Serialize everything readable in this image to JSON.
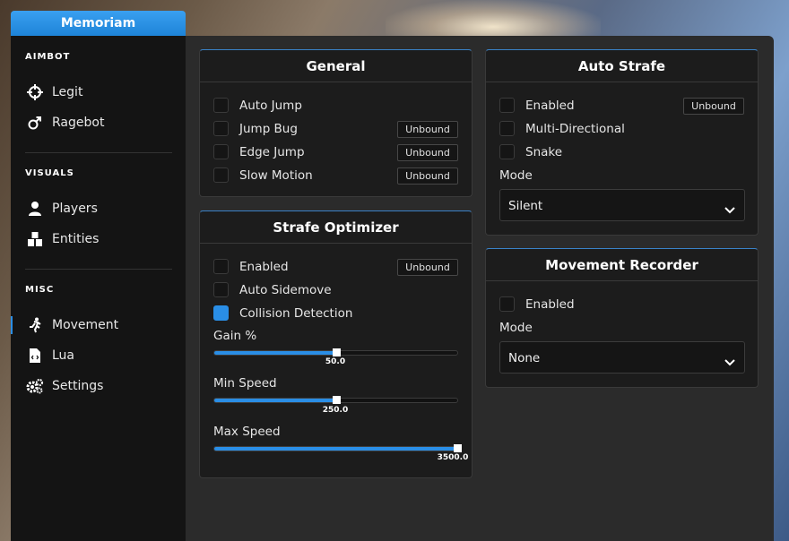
{
  "app": {
    "title": "Memoriam",
    "accent": "#2a8ee6"
  },
  "sidebar": {
    "sections": [
      {
        "title": "AIMBOT"
      },
      {
        "title": "VISUALS"
      },
      {
        "title": "MISC"
      }
    ],
    "items": [
      {
        "label": "Legit",
        "icon": "crosshair-icon"
      },
      {
        "label": "Ragebot",
        "icon": "gender-icon"
      },
      {
        "label": "Players",
        "icon": "person-icon"
      },
      {
        "label": "Entities",
        "icon": "entities-icon"
      },
      {
        "label": "Movement",
        "icon": "running-icon",
        "active": true
      },
      {
        "label": "Lua",
        "icon": "lua-file-icon"
      },
      {
        "label": "Settings",
        "icon": "gears-icon"
      }
    ]
  },
  "general": {
    "title": "General",
    "rows": [
      {
        "label": "Auto Jump",
        "checked": false,
        "keybind": ""
      },
      {
        "label": "Jump Bug",
        "checked": false,
        "keybind": "Unbound"
      },
      {
        "label": "Edge Jump",
        "checked": false,
        "keybind": "Unbound"
      },
      {
        "label": "Slow Motion",
        "checked": false,
        "keybind": "Unbound"
      }
    ]
  },
  "strafe_optimizer": {
    "title": "Strafe Optimizer",
    "rows": [
      {
        "label": "Enabled",
        "checked": false,
        "keybind": "Unbound"
      },
      {
        "label": "Auto Sidemove",
        "checked": false,
        "keybind": ""
      },
      {
        "label": "Collision Detection",
        "checked": true,
        "keybind": ""
      }
    ],
    "sliders": [
      {
        "label": "Gain %",
        "value": "50.0",
        "fraction": 0.5
      },
      {
        "label": "Min Speed",
        "value": "250.0",
        "fraction": 0.5
      },
      {
        "label": "Max Speed",
        "value": "3500.0",
        "fraction": 1.0
      }
    ]
  },
  "auto_strafe": {
    "title": "Auto Strafe",
    "rows": [
      {
        "label": "Enabled",
        "checked": false,
        "keybind": "Unbound"
      },
      {
        "label": "Multi-Directional",
        "checked": false,
        "keybind": ""
      },
      {
        "label": "Snake",
        "checked": false,
        "keybind": ""
      }
    ],
    "mode_label": "Mode",
    "mode_value": "Silent"
  },
  "movement_recorder": {
    "title": "Movement Recorder",
    "rows": [
      {
        "label": "Enabled",
        "checked": false,
        "keybind": ""
      }
    ],
    "mode_label": "Mode",
    "mode_value": "None"
  }
}
